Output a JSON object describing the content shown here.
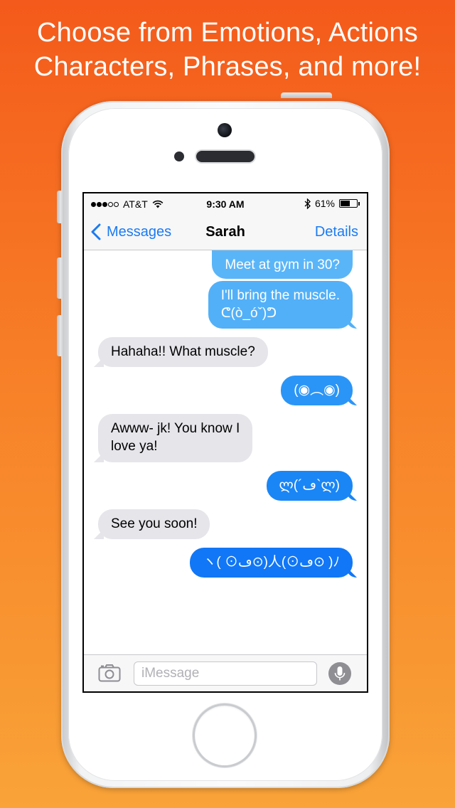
{
  "promo": {
    "line1": "Choose from Emotions, Actions",
    "line2": "Characters, Phrases, and more!"
  },
  "status_bar": {
    "carrier": "AT&T",
    "time": "9:30 AM",
    "battery": "61%",
    "battery_level": 0.61,
    "signal_bars": 3,
    "signal_max": 5
  },
  "nav": {
    "back_label": "Messages",
    "title": "Sarah",
    "details_label": "Details"
  },
  "messages": [
    {
      "from": "me",
      "text": "Meet at gym in 30?"
    },
    {
      "from": "me",
      "text": "I'll bring the muscle.\nᕦ(ò_óˇ)ᕤ"
    },
    {
      "from": "them",
      "text": "Hahaha!! What muscle?"
    },
    {
      "from": "me",
      "text": "(◉︵◉)"
    },
    {
      "from": "them",
      "text": "Awww- jk! You know I\nlove ya!"
    },
    {
      "from": "me",
      "text": "ლ(´ڡ`ლ)"
    },
    {
      "from": "them",
      "text": "See you soon!"
    },
    {
      "from": "me",
      "text": "ヽ( ⊙ڡ⊙)人(⊙ڡ⊙ )ﾉ"
    }
  ],
  "compose": {
    "placeholder": "iMessage"
  },
  "icons": {
    "back": "chevron-left-icon",
    "camera": "camera-icon",
    "microphone": "microphone-icon",
    "wifi": "wifi-icon",
    "bluetooth": "bluetooth-icon",
    "battery": "battery-icon"
  },
  "colors": {
    "background_top": "#f45a1b",
    "background_bottom": "#f9a338",
    "ios_blue": "#1a7bf2",
    "outgoing_bubble": "#1a86f6",
    "incoming_bubble": "#e5e5ea"
  }
}
